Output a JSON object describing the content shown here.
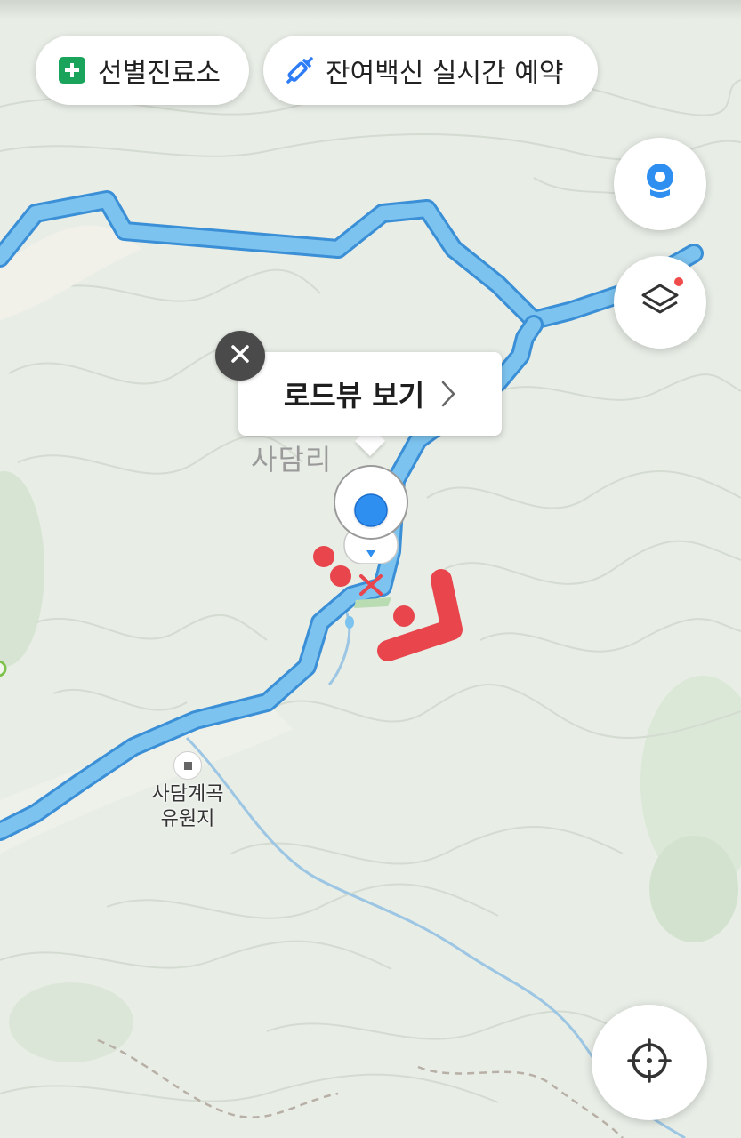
{
  "top_chips": {
    "clinic": {
      "label": "선별진료소",
      "icon": "plus-square-icon",
      "color": "#1aa35a"
    },
    "vaccine": {
      "label": "잔여백신 실시간 예약",
      "icon": "syringe-icon",
      "color": "#2e7cf6"
    }
  },
  "callout": {
    "label": "로드뷰 보기",
    "close_icon": "close-icon",
    "arrow_icon": "chevron-right-icon"
  },
  "map_labels": {
    "village": "사담리",
    "poi": [
      "사담계곡",
      "유원지"
    ]
  },
  "controls": {
    "roadview": "roadview-icon",
    "layers": "layers-icon",
    "locate": "crosshair-icon"
  },
  "colors": {
    "road": "#7cc3ef",
    "road_outline": "#3a8fd6",
    "accent_blue": "#2e7cf6",
    "marking_red": "#e8454d",
    "map_bg": "#e8ede6"
  }
}
